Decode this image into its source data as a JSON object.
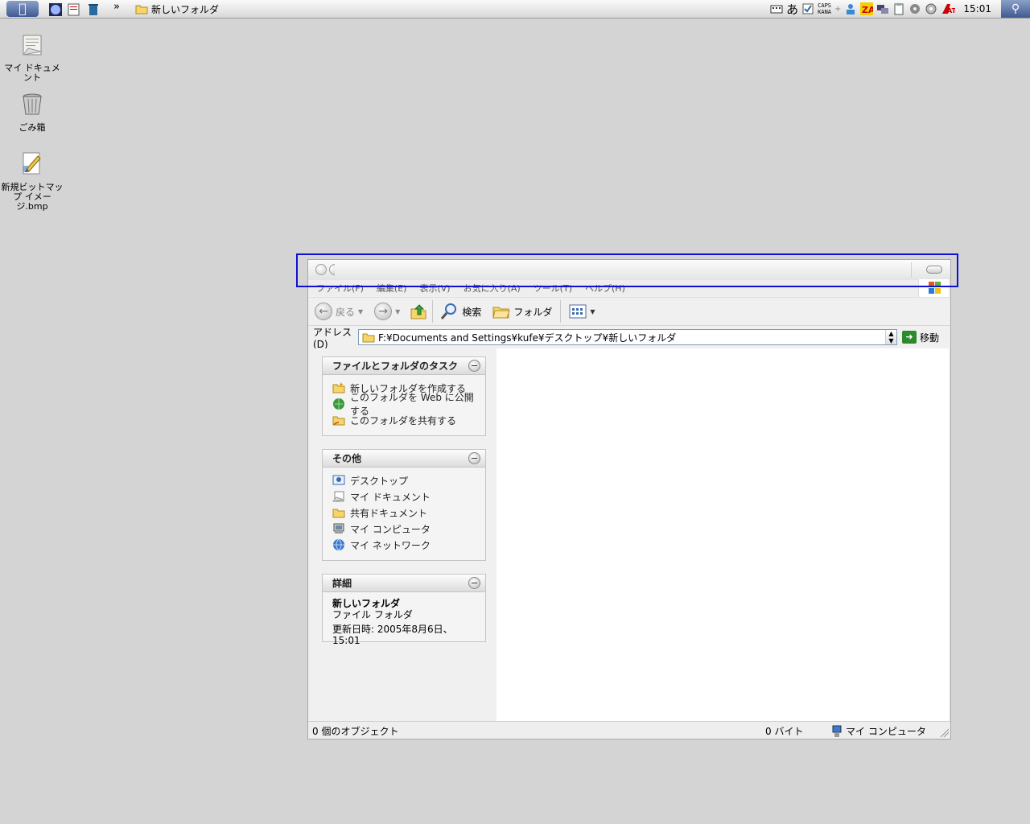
{
  "menubar": {
    "active_folder": "新しいフォルダ",
    "overflow": "»",
    "ime": "あ",
    "caps": "CAPS",
    "kana": "KANA",
    "clock": "15:01"
  },
  "desktop": {
    "icons": [
      {
        "label": "マイ ドキュメント"
      },
      {
        "label": "ごみ箱"
      },
      {
        "label": "新規ビットマップ イメージ.bmp"
      }
    ]
  },
  "window": {
    "menu": [
      "ファイル(F)",
      "編集(E)",
      "表示(V)",
      "お気に入り(A)",
      "ツール(T)",
      "ヘルプ(H)"
    ],
    "toolbar": {
      "back": "戻る",
      "search": "検索",
      "folders": "フォルダ"
    },
    "address": {
      "label": "アドレス(D)",
      "value": "F:¥Documents and Settings¥kufe¥デスクトップ¥新しいフォルダ",
      "go": "移動"
    },
    "tasks_panel": {
      "title": "ファイルとフォルダのタスク",
      "items": [
        {
          "label": "新しいフォルダを作成する"
        },
        {
          "label": "このフォルダを Web に公開する"
        },
        {
          "label": "このフォルダを共有する"
        }
      ]
    },
    "other_panel": {
      "title": "その他",
      "items": [
        {
          "label": "デスクトップ"
        },
        {
          "label": "マイ ドキュメント"
        },
        {
          "label": "共有ドキュメント"
        },
        {
          "label": "マイ コンピュータ"
        },
        {
          "label": "マイ ネットワーク"
        }
      ]
    },
    "details_panel": {
      "title": "詳細",
      "name": "新しいフォルダ",
      "type": "ファイル フォルダ",
      "modified": "更新日時: 2005年8月6日、15:01"
    },
    "status": {
      "objects": "0 個のオブジェクト",
      "size": "0 バイト",
      "zone": "マイ コンピュータ"
    }
  },
  "colors": {
    "desktop": "#d4d4d4",
    "highlight": "#1010d0"
  }
}
